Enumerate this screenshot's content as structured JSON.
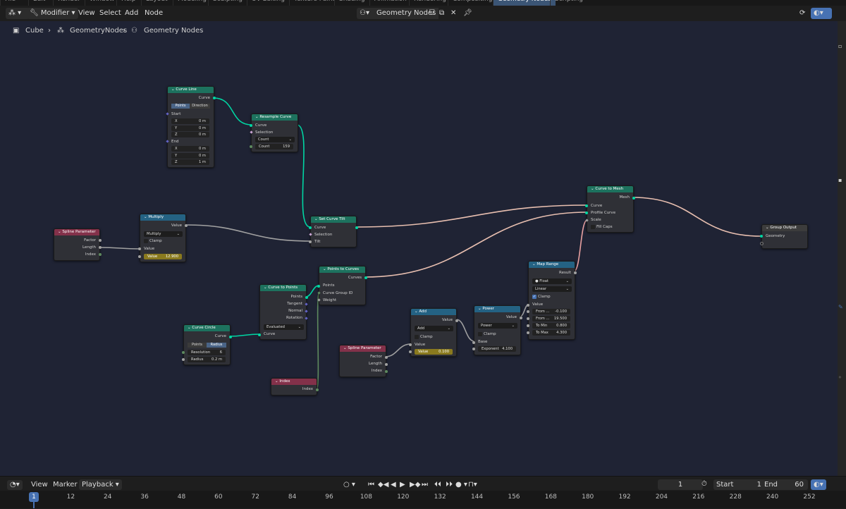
{
  "topbar": {
    "menus": [
      "File",
      "Edit",
      "Render",
      "Window",
      "Help"
    ],
    "workspace_tabs": [
      "Layout",
      "Modeling",
      "Sculpting",
      "UV Editing",
      "Texture Paint",
      "Shading",
      "Animation",
      "Rendering",
      "Compositing",
      "Geometry Nodes",
      "Scripting"
    ],
    "active_tab": "Geometry Nodes"
  },
  "header": {
    "editor_mode": "Modifier",
    "menus": [
      "View",
      "Select",
      "Add",
      "Node"
    ],
    "node_tree_name": "Geometry Nodes"
  },
  "breadcrumb": [
    "Cube",
    "GeometryNodes",
    "Geometry Nodes"
  ],
  "nodes": {
    "curve_line": {
      "title": "Curve Line",
      "out_curve": "Curve",
      "mode_points": "Points",
      "mode_direction": "Direction",
      "start": "Start",
      "end": "End",
      "sx": "X",
      "sy": "Y",
      "sz": "Z",
      "start_x": "0 m",
      "start_y": "0 m",
      "start_z": "0 m",
      "end_x": "0 m",
      "end_y": "0 m",
      "end_z": "1 m"
    },
    "resample": {
      "title": "Resample Curve",
      "in_curve": "Curve",
      "in_selection": "Selection",
      "mode": "Count",
      "count_label": "Count",
      "count": "159"
    },
    "set_tilt": {
      "title": "Set Curve Tilt",
      "in_curve": "Curve",
      "in_selection": "Selection",
      "in_tilt": "Tilt"
    },
    "curve_to_mesh": {
      "title": "Curve to Mesh",
      "out_mesh": "Mesh",
      "in_curve": "Curve",
      "in_profile": "Profile Curve",
      "in_scale": "Scale",
      "fill_caps": "Fill Caps"
    },
    "group_output": {
      "title": "Group Output",
      "in_geometry": "Geometry"
    },
    "spline_param_1": {
      "title": "Spline Parameter",
      "factor": "Factor",
      "length": "Length",
      "index": "Index"
    },
    "multiply": {
      "title": "Multiply",
      "out_value": "Value",
      "op": "Multiply",
      "clamp": "Clamp",
      "in_value": "Value",
      "value_label": "Value",
      "value": "12.900"
    },
    "points_to_curves": {
      "title": "Points to Curves",
      "out_curves": "Curves",
      "in_points": "Points",
      "in_group": "Curve Group ID",
      "in_weight": "Weight"
    },
    "curve_to_points": {
      "title": "Curve to Points",
      "out_points": "Points",
      "out_tangent": "Tangent",
      "out_normal": "Normal",
      "out_rotation": "Rotation",
      "mode": "Evaluated",
      "in_curve": "Curve"
    },
    "curve_circle": {
      "title": "Curve Circle",
      "out_curve": "Curve",
      "mode_points": "Points",
      "mode_radius": "Radius",
      "res_label": "Resolution",
      "res": "6",
      "rad_label": "Radius",
      "rad": "0.2 m"
    },
    "index": {
      "title": "Index",
      "out_index": "Index"
    },
    "add": {
      "title": "Add",
      "out_value": "Value",
      "op": "Add",
      "clamp": "Clamp",
      "in_value": "Value",
      "value_label": "Value",
      "value": "0.100"
    },
    "spline_param_2": {
      "title": "Spline Parameter",
      "factor": "Factor",
      "length": "Length",
      "index": "Index"
    },
    "power": {
      "title": "Power",
      "out_value": "Value",
      "op": "Power",
      "clamp": "Clamp",
      "in_base": "Base",
      "exp_label": "Exponent",
      "exp": "4.100"
    },
    "map_range": {
      "title": "Map Range",
      "out_result": "Result",
      "type": "Float",
      "interp": "Linear",
      "clamp": "Clamp",
      "in_value": "Value",
      "from_min_label": "From ...",
      "from_min": "-0.100",
      "from_max_label": "From ...",
      "from_max": "19.500",
      "to_min_label": "To Min",
      "to_min": "0.800",
      "to_max_label": "To Max",
      "to_max": "4.300"
    }
  },
  "timeline": {
    "view": "View",
    "marker": "Marker",
    "playback": "Playback",
    "current_frame": "1",
    "start_label": "Start",
    "start": "1",
    "end_label": "End",
    "end": "60",
    "ticks": [
      "1",
      "12",
      "24",
      "36",
      "48",
      "60",
      "72",
      "84",
      "96",
      "108",
      "120",
      "132",
      "144",
      "156",
      "168",
      "180",
      "192",
      "204",
      "216",
      "228",
      "240",
      "252"
    ]
  },
  "colors": {
    "editor_bg": "#1f2334",
    "geo_socket": "#00d6a3",
    "float_socket": "#a1a1a1",
    "active_tab": "#3b5575"
  }
}
